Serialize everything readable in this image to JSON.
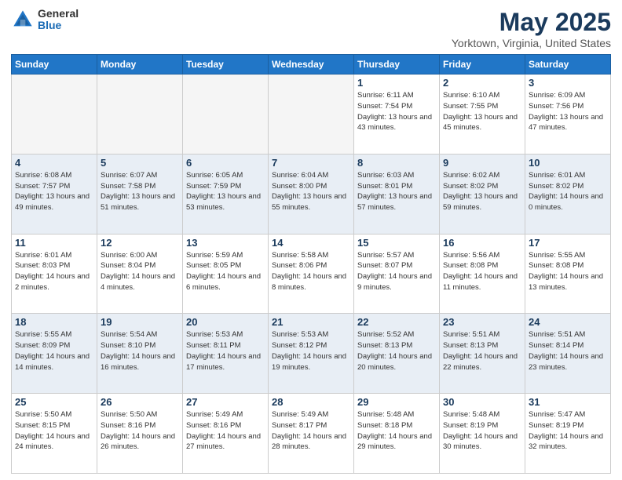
{
  "header": {
    "logo_general": "General",
    "logo_blue": "Blue",
    "title": "May 2025",
    "location": "Yorktown, Virginia, United States"
  },
  "days_of_week": [
    "Sunday",
    "Monday",
    "Tuesday",
    "Wednesday",
    "Thursday",
    "Friday",
    "Saturday"
  ],
  "weeks": [
    {
      "row_class": "row-odd",
      "days": [
        {
          "num": "",
          "empty": true
        },
        {
          "num": "",
          "empty": true
        },
        {
          "num": "",
          "empty": true
        },
        {
          "num": "",
          "empty": true
        },
        {
          "num": "1",
          "sunrise": "Sunrise: 6:11 AM",
          "sunset": "Sunset: 7:54 PM",
          "daylight": "Daylight: 13 hours and 43 minutes."
        },
        {
          "num": "2",
          "sunrise": "Sunrise: 6:10 AM",
          "sunset": "Sunset: 7:55 PM",
          "daylight": "Daylight: 13 hours and 45 minutes."
        },
        {
          "num": "3",
          "sunrise": "Sunrise: 6:09 AM",
          "sunset": "Sunset: 7:56 PM",
          "daylight": "Daylight: 13 hours and 47 minutes."
        }
      ]
    },
    {
      "row_class": "row-even",
      "days": [
        {
          "num": "4",
          "sunrise": "Sunrise: 6:08 AM",
          "sunset": "Sunset: 7:57 PM",
          "daylight": "Daylight: 13 hours and 49 minutes."
        },
        {
          "num": "5",
          "sunrise": "Sunrise: 6:07 AM",
          "sunset": "Sunset: 7:58 PM",
          "daylight": "Daylight: 13 hours and 51 minutes."
        },
        {
          "num": "6",
          "sunrise": "Sunrise: 6:05 AM",
          "sunset": "Sunset: 7:59 PM",
          "daylight": "Daylight: 13 hours and 53 minutes."
        },
        {
          "num": "7",
          "sunrise": "Sunrise: 6:04 AM",
          "sunset": "Sunset: 8:00 PM",
          "daylight": "Daylight: 13 hours and 55 minutes."
        },
        {
          "num": "8",
          "sunrise": "Sunrise: 6:03 AM",
          "sunset": "Sunset: 8:01 PM",
          "daylight": "Daylight: 13 hours and 57 minutes."
        },
        {
          "num": "9",
          "sunrise": "Sunrise: 6:02 AM",
          "sunset": "Sunset: 8:02 PM",
          "daylight": "Daylight: 13 hours and 59 minutes."
        },
        {
          "num": "10",
          "sunrise": "Sunrise: 6:01 AM",
          "sunset": "Sunset: 8:02 PM",
          "daylight": "Daylight: 14 hours and 0 minutes."
        }
      ]
    },
    {
      "row_class": "row-odd",
      "days": [
        {
          "num": "11",
          "sunrise": "Sunrise: 6:01 AM",
          "sunset": "Sunset: 8:03 PM",
          "daylight": "Daylight: 14 hours and 2 minutes."
        },
        {
          "num": "12",
          "sunrise": "Sunrise: 6:00 AM",
          "sunset": "Sunset: 8:04 PM",
          "daylight": "Daylight: 14 hours and 4 minutes."
        },
        {
          "num": "13",
          "sunrise": "Sunrise: 5:59 AM",
          "sunset": "Sunset: 8:05 PM",
          "daylight": "Daylight: 14 hours and 6 minutes."
        },
        {
          "num": "14",
          "sunrise": "Sunrise: 5:58 AM",
          "sunset": "Sunset: 8:06 PM",
          "daylight": "Daylight: 14 hours and 8 minutes."
        },
        {
          "num": "15",
          "sunrise": "Sunrise: 5:57 AM",
          "sunset": "Sunset: 8:07 PM",
          "daylight": "Daylight: 14 hours and 9 minutes."
        },
        {
          "num": "16",
          "sunrise": "Sunrise: 5:56 AM",
          "sunset": "Sunset: 8:08 PM",
          "daylight": "Daylight: 14 hours and 11 minutes."
        },
        {
          "num": "17",
          "sunrise": "Sunrise: 5:55 AM",
          "sunset": "Sunset: 8:08 PM",
          "daylight": "Daylight: 14 hours and 13 minutes."
        }
      ]
    },
    {
      "row_class": "row-even",
      "days": [
        {
          "num": "18",
          "sunrise": "Sunrise: 5:55 AM",
          "sunset": "Sunset: 8:09 PM",
          "daylight": "Daylight: 14 hours and 14 minutes."
        },
        {
          "num": "19",
          "sunrise": "Sunrise: 5:54 AM",
          "sunset": "Sunset: 8:10 PM",
          "daylight": "Daylight: 14 hours and 16 minutes."
        },
        {
          "num": "20",
          "sunrise": "Sunrise: 5:53 AM",
          "sunset": "Sunset: 8:11 PM",
          "daylight": "Daylight: 14 hours and 17 minutes."
        },
        {
          "num": "21",
          "sunrise": "Sunrise: 5:53 AM",
          "sunset": "Sunset: 8:12 PM",
          "daylight": "Daylight: 14 hours and 19 minutes."
        },
        {
          "num": "22",
          "sunrise": "Sunrise: 5:52 AM",
          "sunset": "Sunset: 8:13 PM",
          "daylight": "Daylight: 14 hours and 20 minutes."
        },
        {
          "num": "23",
          "sunrise": "Sunrise: 5:51 AM",
          "sunset": "Sunset: 8:13 PM",
          "daylight": "Daylight: 14 hours and 22 minutes."
        },
        {
          "num": "24",
          "sunrise": "Sunrise: 5:51 AM",
          "sunset": "Sunset: 8:14 PM",
          "daylight": "Daylight: 14 hours and 23 minutes."
        }
      ]
    },
    {
      "row_class": "row-odd",
      "days": [
        {
          "num": "25",
          "sunrise": "Sunrise: 5:50 AM",
          "sunset": "Sunset: 8:15 PM",
          "daylight": "Daylight: 14 hours and 24 minutes."
        },
        {
          "num": "26",
          "sunrise": "Sunrise: 5:50 AM",
          "sunset": "Sunset: 8:16 PM",
          "daylight": "Daylight: 14 hours and 26 minutes."
        },
        {
          "num": "27",
          "sunrise": "Sunrise: 5:49 AM",
          "sunset": "Sunset: 8:16 PM",
          "daylight": "Daylight: 14 hours and 27 minutes."
        },
        {
          "num": "28",
          "sunrise": "Sunrise: 5:49 AM",
          "sunset": "Sunset: 8:17 PM",
          "daylight": "Daylight: 14 hours and 28 minutes."
        },
        {
          "num": "29",
          "sunrise": "Sunrise: 5:48 AM",
          "sunset": "Sunset: 8:18 PM",
          "daylight": "Daylight: 14 hours and 29 minutes."
        },
        {
          "num": "30",
          "sunrise": "Sunrise: 5:48 AM",
          "sunset": "Sunset: 8:19 PM",
          "daylight": "Daylight: 14 hours and 30 minutes."
        },
        {
          "num": "31",
          "sunrise": "Sunrise: 5:47 AM",
          "sunset": "Sunset: 8:19 PM",
          "daylight": "Daylight: 14 hours and 32 minutes."
        }
      ]
    }
  ]
}
